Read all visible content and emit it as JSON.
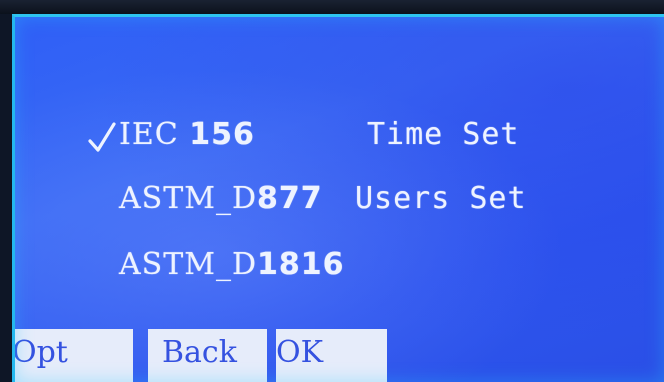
{
  "menu": {
    "selected_mark": "✓",
    "standards": [
      {
        "prefix": "IEC ",
        "number": "156"
      },
      {
        "prefix": "ASTM_D",
        "number": "877"
      },
      {
        "prefix": "ASTM_D",
        "number": "1816"
      }
    ],
    "settings": [
      {
        "label": "Time Set"
      },
      {
        "label": "Users Set"
      }
    ]
  },
  "softkeys": {
    "opt": "Opt",
    "back": "Back",
    "ok": "OK"
  },
  "colors": {
    "screen": "#3a6af4",
    "text": "#eef3ff",
    "softkey_bg": "#e6ecfa",
    "softkey_text": "#3552e0",
    "glow": "#2ec4f0"
  }
}
